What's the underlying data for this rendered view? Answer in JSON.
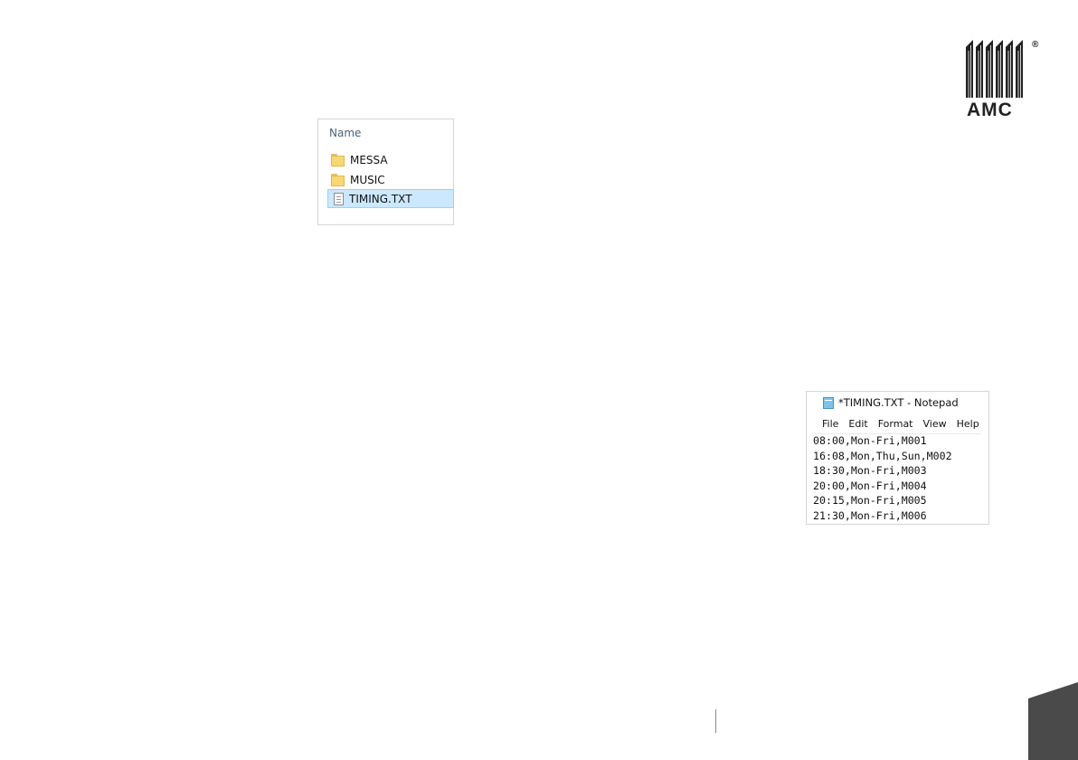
{
  "logo": {
    "text": "AMC",
    "registered": "®",
    "color": "#222222"
  },
  "explorer": {
    "column_header": "Name",
    "items": [
      {
        "label": "MESSA",
        "icon": "folder-icon",
        "selected": false
      },
      {
        "label": "MUSIC",
        "icon": "folder-icon",
        "selected": false
      },
      {
        "label": "TIMING.TXT",
        "icon": "text-file-icon",
        "selected": true
      }
    ],
    "selection_color": "#cce8ff"
  },
  "notepad": {
    "title": "*TIMING.TXT - Notepad",
    "menu": [
      "File",
      "Edit",
      "Format",
      "View",
      "Help"
    ],
    "lines": [
      "08:00,Mon-Fri,M001",
      "16:08,Mon,Thu,Sun,M002",
      "18:30,Mon-Fri,M003",
      "20:00,Mon-Fri,M004",
      "20:15,Mon-Fri,M005",
      "21:30,Mon-Fri,M006"
    ]
  },
  "footer": {
    "tab_color": "#4a4a4a"
  }
}
